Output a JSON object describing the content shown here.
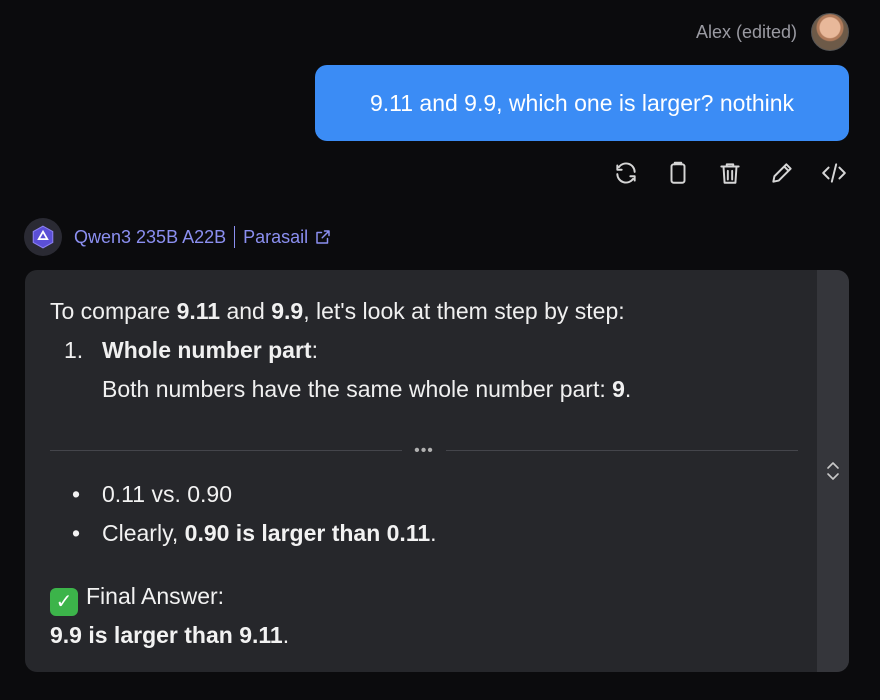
{
  "user": {
    "name": "Alex (edited)",
    "message": "9.11 and 9.9, which one is larger? nothink"
  },
  "actions": [
    {
      "name": "regenerate-icon"
    },
    {
      "name": "copy-icon"
    },
    {
      "name": "delete-icon"
    },
    {
      "name": "edit-icon"
    },
    {
      "name": "code-icon"
    }
  ],
  "bot": {
    "model": "Qwen3 235B A22B",
    "provider": "Parasail",
    "intro_pre": "To compare ",
    "intro_b1": "9.11",
    "intro_mid": " and ",
    "intro_b2": "9.9",
    "intro_post": ", let's look at them step by step:",
    "step1_num": "1.",
    "step1_title": "Whole number part",
    "step1_colon": ":",
    "step1_text_pre": "Both numbers have the same whole number part: ",
    "step1_text_b": "9",
    "step1_text_post": ".",
    "divider_dots": "•••",
    "bullet1": "0.11 vs. 0.90",
    "bullet2_pre": "Clearly, ",
    "bullet2_b": "0.90 is larger than 0.11",
    "bullet2_post": ".",
    "final_check": "✓",
    "final_label": "Final Answer:",
    "final_b": "9.9 is larger than 9.11",
    "final_post": "."
  },
  "colors": {
    "background": "#0b0b0d",
    "user_bubble": "#3b8cf5",
    "card": "#26272b",
    "model_link": "#8b8ff0",
    "check": "#3cb44a"
  }
}
